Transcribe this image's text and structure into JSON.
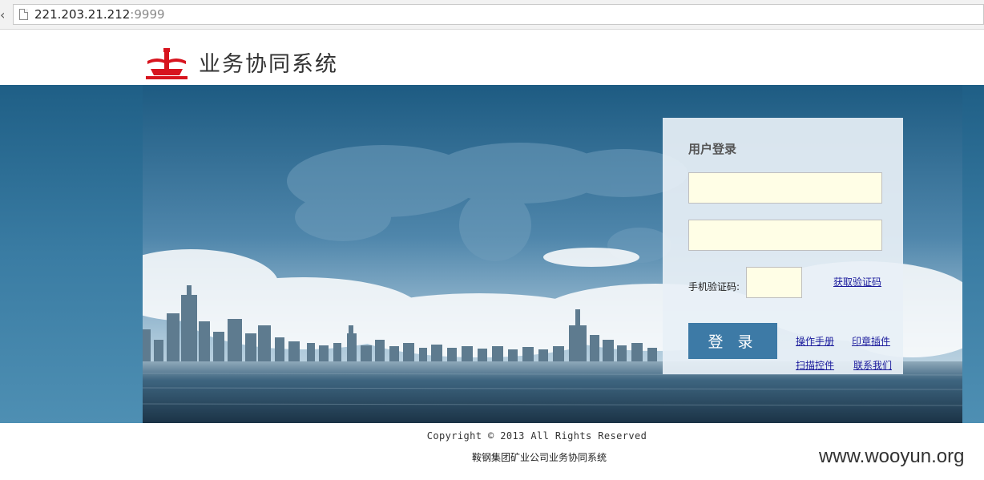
{
  "browser": {
    "url_host": "221.203.21.212",
    "url_port": ":9999",
    "page_icon": "page-icon"
  },
  "header": {
    "title": "业务协同系统",
    "logo_icon": "company-logo-icon"
  },
  "login": {
    "title": "用户登录",
    "username_value": "",
    "password_value": "",
    "sms_label": "手机验证码:",
    "sms_value": "",
    "get_code_link": "获取验证码",
    "login_button": "登 录",
    "links": {
      "manual": "操作手册",
      "seal_plugin": "印章插件",
      "scan_control": "扫描控件",
      "contact": "联系我们"
    }
  },
  "footer": {
    "copyright": "Copyright © 2013 All Rights Reserved",
    "company": "鞍钢集团矿业公司业务协同系统"
  },
  "watermark": "www.wooyun.org",
  "colors": {
    "accent": "#3d7aa6",
    "input_bg": "#fffee6",
    "logo_red": "#d7141e",
    "link": "#1a1a9c"
  }
}
